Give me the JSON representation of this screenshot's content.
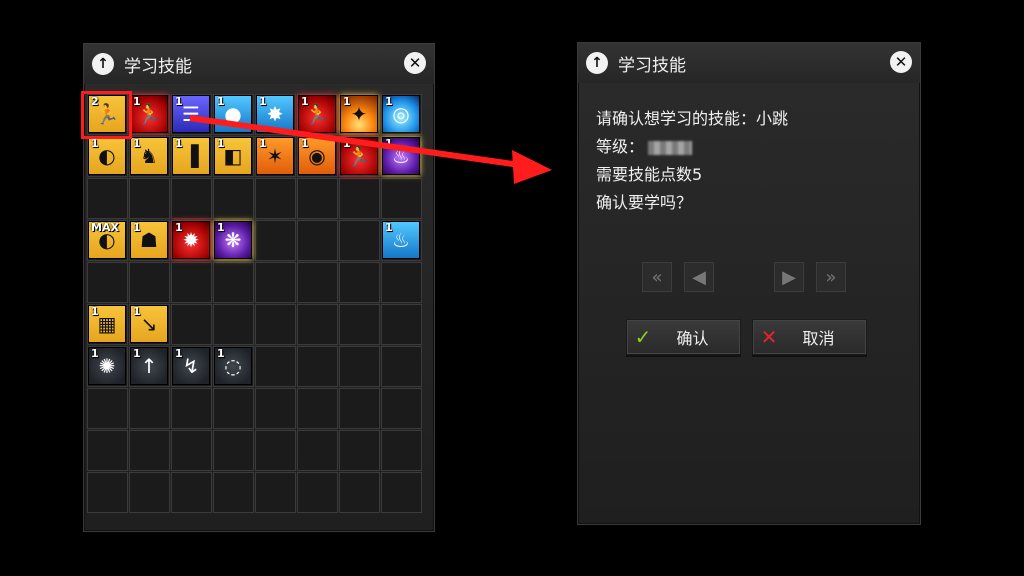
{
  "left_panel": {
    "title": "学习技能",
    "up_icon": "arrow-up-icon",
    "close_icon": "close-icon"
  },
  "skills": [
    {
      "level": "2",
      "color": "y",
      "glyph": "🏃",
      "col": 0,
      "row": 0
    },
    {
      "level": "1",
      "color": "r",
      "glyph": "🏃",
      "col": 1,
      "row": 0
    },
    {
      "level": "1",
      "color": "b",
      "glyph": "☰",
      "col": 2,
      "row": 0
    },
    {
      "level": "1",
      "color": "c",
      "glyph": "●",
      "col": 3,
      "row": 0
    },
    {
      "level": "1",
      "color": "c",
      "glyph": "✸",
      "col": 4,
      "row": 0
    },
    {
      "level": "1",
      "color": "r",
      "glyph": "🏃",
      "col": 5,
      "row": 0
    },
    {
      "level": "1",
      "color": "fire",
      "glyph": "✦",
      "col": 6,
      "row": 0
    },
    {
      "level": "1",
      "color": "water",
      "glyph": "◎",
      "col": 7,
      "row": 0
    },
    {
      "level": "1",
      "color": "y",
      "glyph": "◐",
      "col": 0,
      "row": 1
    },
    {
      "level": "1",
      "color": "y",
      "glyph": "♞",
      "col": 1,
      "row": 1
    },
    {
      "level": "1",
      "color": "y",
      "glyph": "▐",
      "col": 2,
      "row": 1
    },
    {
      "level": "1",
      "color": "y",
      "glyph": "◧",
      "col": 3,
      "row": 1
    },
    {
      "level": "1",
      "color": "o",
      "glyph": "✶",
      "col": 4,
      "row": 1
    },
    {
      "level": "1",
      "color": "o",
      "glyph": "◉",
      "col": 5,
      "row": 1
    },
    {
      "level": "1",
      "color": "r",
      "glyph": "🏃",
      "col": 6,
      "row": 1
    },
    {
      "level": "1",
      "color": "p",
      "glyph": "♨",
      "col": 7,
      "row": 1
    },
    {
      "level": "MAX",
      "color": "y",
      "glyph": "◐",
      "col": 0,
      "row": 3
    },
    {
      "level": "1",
      "color": "y",
      "glyph": "☗",
      "col": 1,
      "row": 3
    },
    {
      "level": "1",
      "color": "r",
      "glyph": "✹",
      "col": 2,
      "row": 3
    },
    {
      "level": "1",
      "color": "p",
      "glyph": "❋",
      "col": 3,
      "row": 3
    },
    {
      "level": "1",
      "color": "c",
      "glyph": "♨",
      "col": 7,
      "row": 3
    },
    {
      "level": "1",
      "color": "y",
      "glyph": "▦",
      "col": 0,
      "row": 5
    },
    {
      "level": "1",
      "color": "y",
      "glyph": "↘",
      "col": 1,
      "row": 5
    },
    {
      "level": "1",
      "color": "g",
      "glyph": "✺",
      "col": 0,
      "row": 6
    },
    {
      "level": "1",
      "color": "g",
      "glyph": "↑",
      "col": 1,
      "row": 6
    },
    {
      "level": "1",
      "color": "g",
      "glyph": "↯",
      "col": 2,
      "row": 6
    },
    {
      "level": "1",
      "color": "g",
      "glyph": "◌",
      "col": 3,
      "row": 6
    }
  ],
  "confirm_panel": {
    "title": "学习技能",
    "line1": "请确认想学习的技能：小跳",
    "line2_label": "等级：",
    "line3": "需要技能点数5",
    "line4": "确认要学吗？",
    "nav": {
      "first": "«",
      "prev": "◀",
      "next": "▶",
      "last": "»"
    },
    "confirm_label": "确认",
    "cancel_label": "取消",
    "confirm_icon": "checkmark-icon",
    "cancel_icon": "x-mark-icon"
  },
  "colors": {
    "highlight": "#ff1c1c",
    "check": "#8fd11b",
    "cross": "#e3252b"
  }
}
